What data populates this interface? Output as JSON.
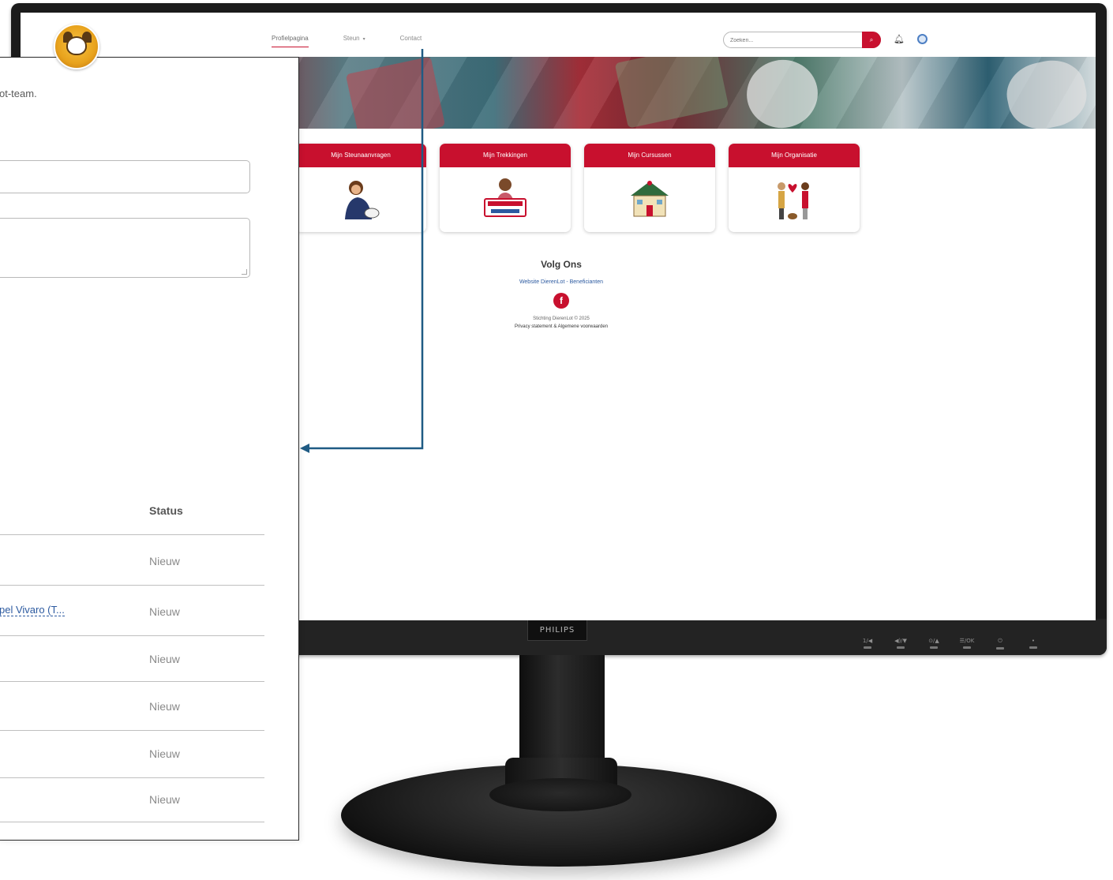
{
  "site": {
    "nav": {
      "links": [
        "Profielpagina",
        "Steun",
        "Contact"
      ]
    },
    "search": {
      "placeholder": "Zoeken..."
    },
    "tiles": [
      "Mijn Steunaanvragen",
      "Mijn Trekkingen",
      "Mijn Cursussen",
      "Mijn Organisatie"
    ],
    "footer": {
      "follow_title": "Volg Ons",
      "links": "Website DierenLot - Beneficianten",
      "copyright": "Stichting DierenLot © 2025",
      "privacy": "Privacy statement & Algemene voorwaarden"
    }
  },
  "panel": {
    "intro_fragment": "ot-team.",
    "table": {
      "status_header": "Status",
      "linked_row_text": "pel Vivaro (T...",
      "rows": [
        "Nieuw",
        "Nieuw",
        "Nieuw",
        "Nieuw",
        "Nieuw",
        "Nieuw"
      ]
    }
  },
  "monitor": {
    "brand": "PHILIPS",
    "controls": [
      "1/◀",
      "◀)/▼",
      "⊙/▲",
      "☰/OK",
      "⏻",
      "•"
    ]
  },
  "colors": {
    "brand_red": "#c8102e",
    "connector": "#1f5b84",
    "link_blue": "#2c5aa0"
  }
}
